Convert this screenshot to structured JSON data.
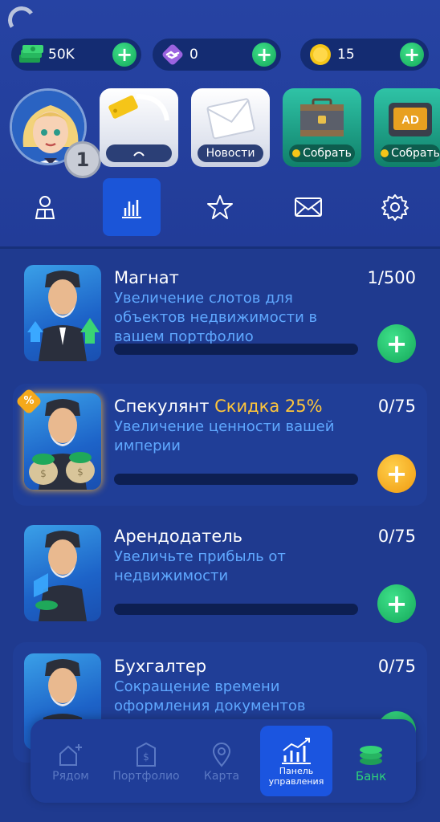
{
  "currencies": {
    "cash": {
      "value": "50K",
      "icon": "cash-stack-icon"
    },
    "deals": {
      "value": "0",
      "icon": "handshake-icon"
    },
    "coins": {
      "value": "15",
      "icon": "coin-icon"
    }
  },
  "profile": {
    "level": "1"
  },
  "tiles": {
    "news_label": "Новости",
    "collect_label_1": "Собрать",
    "collect_label_2": "Собрать"
  },
  "colors": {
    "accent": "#1b55d8",
    "green": "#14a859",
    "orange": "#f09a10",
    "discount": "#ffc63a",
    "desc": "#5fa8ff"
  },
  "upgrades": [
    {
      "title": "Магнат",
      "discount": "",
      "description": "Увеличение слотов для объектов недвижимости в вашем портфолио",
      "count": "1/500",
      "progress": 0.002
    },
    {
      "title": "Спекулянт",
      "discount": "Скидка 25%",
      "description": "Увеличение ценности вашей империи",
      "count": "0/75",
      "progress": 0,
      "badge": "%"
    },
    {
      "title": "Арендодатель",
      "discount": "",
      "description": "Увеличьте прибыль от недвижимости",
      "count": "0/75",
      "progress": 0
    },
    {
      "title": "Бухгалтер",
      "discount": "",
      "description": "Сокращение времени оформления документов",
      "count": "0/75",
      "progress": 0
    }
  ],
  "bottom_nav": {
    "nearby": "Рядом",
    "portfolio": "Портфолио",
    "map": "Карта",
    "dashboard": "Панель управления",
    "bank": "Банк"
  }
}
